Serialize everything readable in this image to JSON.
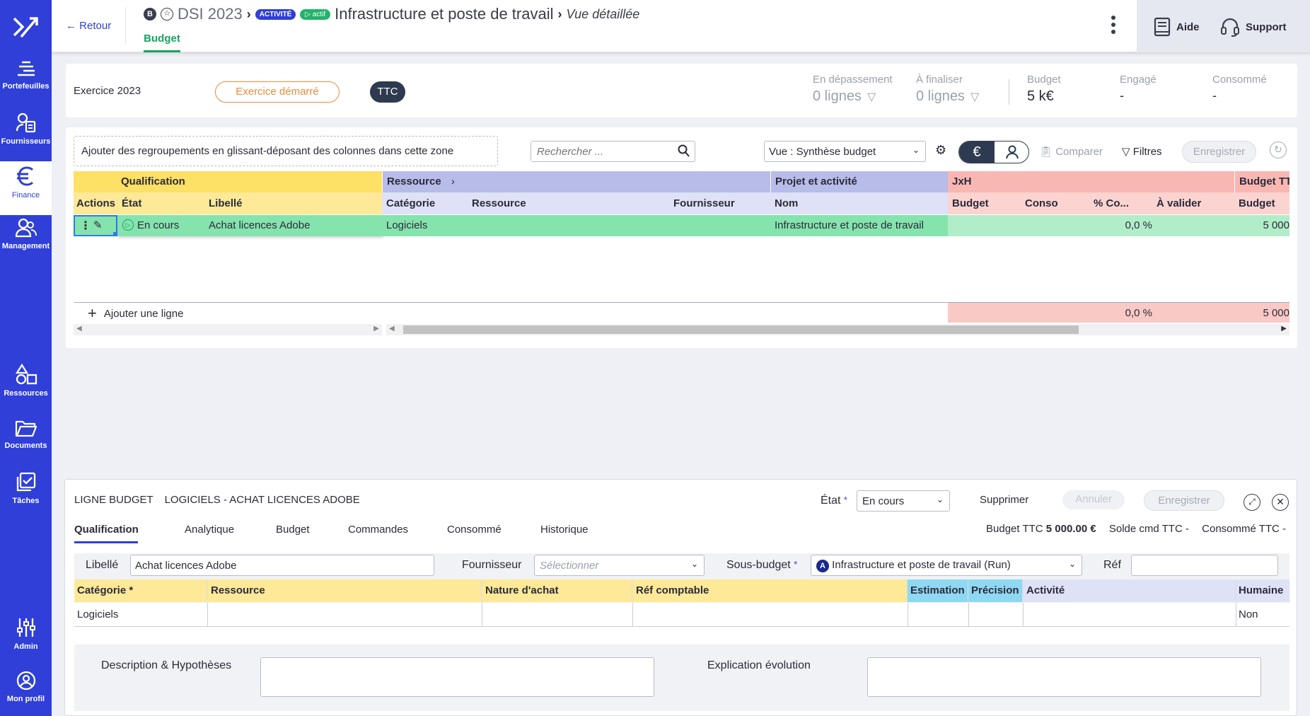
{
  "sidebar": {
    "items": [
      {
        "label": "Portefeuilles",
        "icon": "portfolio-icon"
      },
      {
        "label": "Fournisseurs",
        "icon": "suppliers-icon"
      },
      {
        "label": "Finance",
        "icon": "euro-icon"
      },
      {
        "label": "Management",
        "icon": "people-icon"
      },
      {
        "label": "Ressources",
        "icon": "shapes-icon"
      },
      {
        "label": "Documents",
        "icon": "folder-icon"
      },
      {
        "label": "Tâches",
        "icon": "tasks-icon"
      },
      {
        "label": "Admin",
        "icon": "sliders-icon"
      },
      {
        "label": "Mon profil",
        "icon": "profile-icon"
      }
    ]
  },
  "header": {
    "back_label": "Retour",
    "badge_b": "B",
    "project": "DSI 2023",
    "tag_activity": "ACTIVITÉ",
    "tag_active": "▷ actif",
    "title": "Infrastructure et poste de travail",
    "view": "Vue détaillée",
    "tab_budget": "Budget",
    "help_label": "Aide",
    "support_label": "Support"
  },
  "summary": {
    "exercise": "Exercice 2023",
    "exercise_status": "Exercice démarré",
    "ttc": "TTC",
    "kpis": {
      "over_label": "En dépassement",
      "over_value": "0 lignes",
      "finalize_label": "À finaliser",
      "finalize_value": "0 lignes",
      "budget_label": "Budget",
      "budget_value": "5 k€",
      "engaged_label": "Engagé",
      "engaged_value": "-",
      "consumed_label": "Consommé",
      "consumed_value": "-"
    }
  },
  "toolbar": {
    "grouping_hint": "Ajouter des regroupements en glissant-déposant des colonnes dans cette zone",
    "search_placeholder": "Rechercher ...",
    "view_select": "Vue : Synthèse budget",
    "compare": "Comparer",
    "filters": "Filtres",
    "save": "Enregistrer"
  },
  "grid": {
    "groups": {
      "qualification": "Qualification",
      "ressource": "Ressource",
      "projet": "Projet et activité",
      "jxh": "JxH",
      "budget_ttc": "Budget TT"
    },
    "columns": {
      "actions": "Actions",
      "etat": "État",
      "libelle": "Libellé",
      "categorie": "Catégorie",
      "ressource": "Ressource",
      "fournisseur": "Fournisseur",
      "nom": "Nom",
      "budget": "Budget",
      "conso": "Conso",
      "pct_conso": "% Co...",
      "a_valider": "À valider",
      "budget2": "Budget"
    },
    "row": {
      "etat": "En cours",
      "libelle": "Achat licences Adobe",
      "categorie": "Logiciels",
      "nom": "Infrastructure et poste de travail",
      "pct_conso": "0,0 %",
      "budget2": "5 000"
    },
    "add_line": "Ajouter une ligne",
    "totals": {
      "pct_conso": "0,0 %",
      "budget2": "5 000"
    }
  },
  "detail": {
    "kind": "LIGNE BUDGET",
    "name": "LOGICIELS - ACHAT LICENCES ADOBE",
    "state_label": "État",
    "state_required": "*",
    "state_value": "En cours",
    "delete": "Supprimer",
    "cancel": "Annuler",
    "save": "Enregistrer",
    "tabs": [
      "Qualification",
      "Analytique",
      "Budget",
      "Commandes",
      "Consommé",
      "Historique"
    ],
    "stats": {
      "budget_label": "Budget TTC",
      "budget_value": "5 000.00 €",
      "solde_label": "Solde cmd TTC",
      "solde_value": "-",
      "consumed_label": "Consommé TTC",
      "consumed_value": "-"
    },
    "form": {
      "libelle_label": "Libellé",
      "libelle_value": "Achat licences Adobe",
      "fournisseur_label": "Fournisseur",
      "fournisseur_placeholder": "Sélectionner",
      "sous_budget_label": "Sous-budget",
      "sous_budget_badge": "A",
      "sous_budget_value": "Infrastructure et poste de travail (Run)",
      "ref_label": "Réf"
    },
    "table": {
      "headers": [
        "Catégorie *",
        "Ressource",
        "Nature d'achat",
        "Réf comptable",
        "Estimation",
        "Précision",
        "Activité",
        "Humaine"
      ],
      "row": [
        "Logiciels",
        "",
        "",
        "",
        "",
        "",
        "",
        "Non"
      ]
    },
    "description_label": "Description & Hypothèses",
    "evolution_label": "Explication évolution"
  },
  "colors": {
    "sidebar": "#2f3fd8",
    "accent_green": "#1aa35f",
    "qualification": "#fde066",
    "ressource": "#b7bce9",
    "jxh": "#f9b7b3",
    "row_green": "#85e3ad"
  }
}
